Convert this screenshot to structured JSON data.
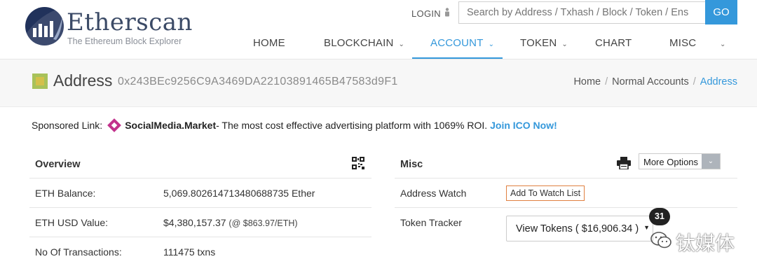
{
  "brand": {
    "name": "Etherscan",
    "tagline": "The Ethereum Block Explorer",
    "accent": "#3498db",
    "logo_color": "#21325b"
  },
  "topbar": {
    "login_label": "LOGIN",
    "search_placeholder": "Search by Address / Txhash / Block / Token / Ens",
    "go_label": "GO"
  },
  "nav": {
    "items": [
      {
        "label": "HOME"
      },
      {
        "label": "BLOCKCHAIN"
      },
      {
        "label": "ACCOUNT"
      },
      {
        "label": "TOKEN"
      },
      {
        "label": "CHART"
      },
      {
        "label": "MISC"
      }
    ],
    "active": "ACCOUNT"
  },
  "page": {
    "title": "Address",
    "address": "0x243BEc9256C9A3469DA22103891465B47583d9F1"
  },
  "breadcrumb": {
    "items": [
      "Home",
      "Normal Accounts",
      "Address"
    ],
    "separator": "/"
  },
  "sponsor": {
    "prefix": "Sponsored Link:",
    "brand": "SocialMedia.Market",
    "text": " - The most cost effective advertising platform with 1069% ROI.",
    "cta": "Join ICO Now!"
  },
  "overview": {
    "title": "Overview",
    "rows": [
      {
        "label": "ETH Balance:",
        "value": "5,069.802614713480688735 Ether"
      },
      {
        "label": "ETH USD Value:",
        "value": "$4,380,157.37",
        "note": "(@ $863.97/ETH)"
      },
      {
        "label": "No Of Transactions:",
        "value": "111475 txns"
      }
    ]
  },
  "misc": {
    "title": "Misc",
    "more_options_label": "More Options",
    "address_watch_label": "Address Watch",
    "watch_button_label": "Add To Watch List",
    "token_tracker_label": "Token Tracker",
    "view_tokens_label": "View Tokens ( $16,906.34 )",
    "token_count": "31"
  },
  "watermark": {
    "text": "钛媒体"
  }
}
